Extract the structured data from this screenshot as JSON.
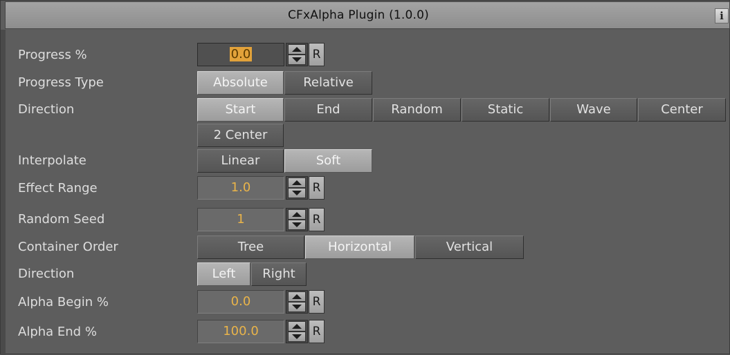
{
  "window": {
    "title": "CFxAlpha Plugin (1.0.0)",
    "info_label": "i"
  },
  "rows": {
    "progress": {
      "label": "Progress %",
      "value": "0.0",
      "reset": "R"
    },
    "progress_type": {
      "label": "Progress Type",
      "options": [
        "Absolute",
        "Relative"
      ],
      "selected": "Absolute"
    },
    "direction": {
      "label": "Direction",
      "options": [
        "Start",
        "End",
        "Random",
        "Static",
        "Wave",
        "Center",
        "2 Center"
      ],
      "selected": "Start"
    },
    "interpolate": {
      "label": "Interpolate",
      "options": [
        "Linear",
        "Soft"
      ],
      "selected": "Soft"
    },
    "effect_range": {
      "label": "Effect Range",
      "value": "1.0",
      "reset": "R"
    },
    "random_seed": {
      "label": "Random Seed",
      "value": "1",
      "reset": "R"
    },
    "container_order": {
      "label": "Container Order",
      "options": [
        "Tree",
        "Horizontal",
        "Vertical"
      ],
      "selected": "Horizontal"
    },
    "direction2": {
      "label": "Direction",
      "options": [
        "Left",
        "Right"
      ],
      "selected": "Left"
    },
    "alpha_begin": {
      "label": "Alpha Begin %",
      "value": "0.0",
      "reset": "R"
    },
    "alpha_end": {
      "label": "Alpha End %",
      "value": "100.0",
      "reset": "R"
    }
  }
}
